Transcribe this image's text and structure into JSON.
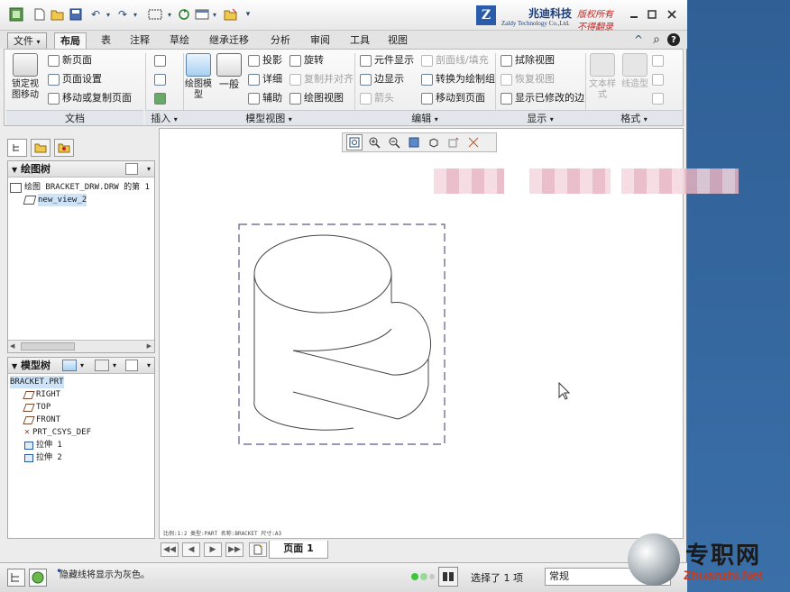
{
  "titlebar": {
    "company_name": "兆迪科技",
    "company_en": "Zaldy Technology Co.,Ltd.",
    "logo_letter": "Z",
    "copyright_line1": "版权所有",
    "copyright_line2": "不得翻录"
  },
  "tabs": [
    {
      "label": "文件",
      "arrow": "▾"
    },
    {
      "label": "布局"
    },
    {
      "label": "表"
    },
    {
      "label": "注释"
    },
    {
      "label": "草绘"
    },
    {
      "label": "继承迁移"
    },
    {
      "label": "分析"
    },
    {
      "label": "审阅"
    },
    {
      "label": "工具"
    },
    {
      "label": "视图"
    }
  ],
  "ribbon": {
    "lock_view": "锁定视图移动",
    "new_page": "新页面",
    "page_setup": "页面设置",
    "move_copy_page": "移动或复制页面",
    "drawing_model": "绘图模型",
    "general": "一般",
    "projection": "投影",
    "detail": "详细",
    "auxiliary": "辅助",
    "revolve": "旋转",
    "copy_align": "复制并对齐",
    "drawing_view": "绘图视图",
    "element_display": "元件显示",
    "edge_display": "边显示",
    "arrow": "箭头",
    "section_fill": "剖面线/填充",
    "convert_group": "转换为绘制组",
    "move_to_page": "移动到页面",
    "erase_view": "拭除视图",
    "restore_view": "恢复视图",
    "show_modified_edges": "显示已修改的边",
    "text_style": "文本样式",
    "line_style": "线造型",
    "groups": {
      "document": "文档",
      "insert": "插入",
      "model_views": "模型视图",
      "edit": "编辑",
      "display": "显示",
      "format": "格式"
    },
    "dropdown_arrow": "▾"
  },
  "drawing_tree": {
    "title": "绘图树",
    "root": "绘图 BRACKET_DRW.DRW 的第 1",
    "child": "new_view_2"
  },
  "model_tree": {
    "title": "模型树",
    "root": "BRACKET.PRT",
    "items": [
      "RIGHT",
      "TOP",
      "FRONT",
      "PRT_CSYS_DEF",
      "拉伸 1",
      "拉伸 2"
    ]
  },
  "graphics": {
    "info_line": "比例:1:2    类型:PART    名称:BRACKET   尺寸:A3"
  },
  "pagebar": {
    "page_label": "页面 1"
  },
  "statusbar": {
    "message": "隐藏线将显示为灰色。",
    "bullet": "•",
    "selection": "选择了 1 项",
    "filter": "常规"
  },
  "watermark": {
    "text": "专职网",
    "url": "Zhuanzhi.Net"
  },
  "icons": {
    "help": "?",
    "search": "⌕",
    "collapse": "^"
  }
}
